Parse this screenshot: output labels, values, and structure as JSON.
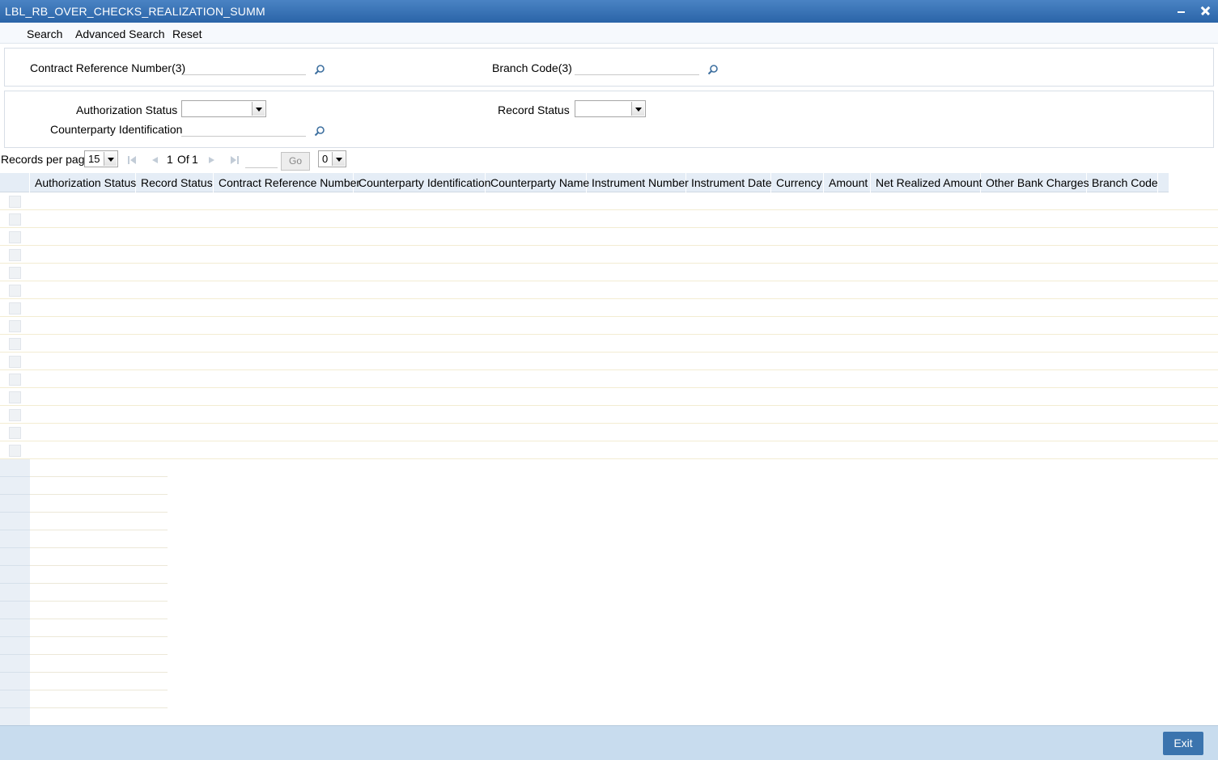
{
  "window": {
    "title": "LBL_RB_OVER_CHECKS_REALIZATION_SUMM"
  },
  "toolbar": {
    "search": "Search",
    "advanced_search": "Advanced Search",
    "reset": "Reset"
  },
  "criteria": {
    "contract_ref_label": "Contract Reference Number(3)",
    "contract_ref_value": "",
    "branch_code_label": "Branch Code(3)",
    "branch_code_value": "",
    "auth_status_label": "Authorization Status",
    "auth_status_value": "",
    "record_status_label": "Record Status",
    "record_status_value": "",
    "counterparty_label": "Counterparty Identification",
    "counterparty_value": ""
  },
  "pagination": {
    "records_per_page_label": "Records per page",
    "records_per_page": "15",
    "current_page": "1",
    "of_label": "Of",
    "total_pages": "1",
    "go_label": "Go",
    "selected_count": "0"
  },
  "grid": {
    "columns": [
      "Authorization Status",
      "Record Status",
      "Contract Reference Number",
      "Counterparty Identification",
      "Counterparty Name",
      "Instrument Number",
      "Instrument Date",
      "Currency",
      "Amount",
      "Net Realized Amount",
      "Other Bank Charges",
      "Branch Code"
    ],
    "rows": []
  },
  "footer": {
    "exit_label": "Exit"
  },
  "colors": {
    "title_bar": "#2f69ad",
    "header_bg": "#e5edf6",
    "footer_bg": "#c8dcee",
    "exit_button": "#3b74ae"
  },
  "icons": [
    "minimize-icon",
    "close-icon",
    "lookup-icon",
    "first-page-icon",
    "prev-page-icon",
    "next-page-icon",
    "last-page-icon",
    "dropdown-arrow-icon"
  ]
}
